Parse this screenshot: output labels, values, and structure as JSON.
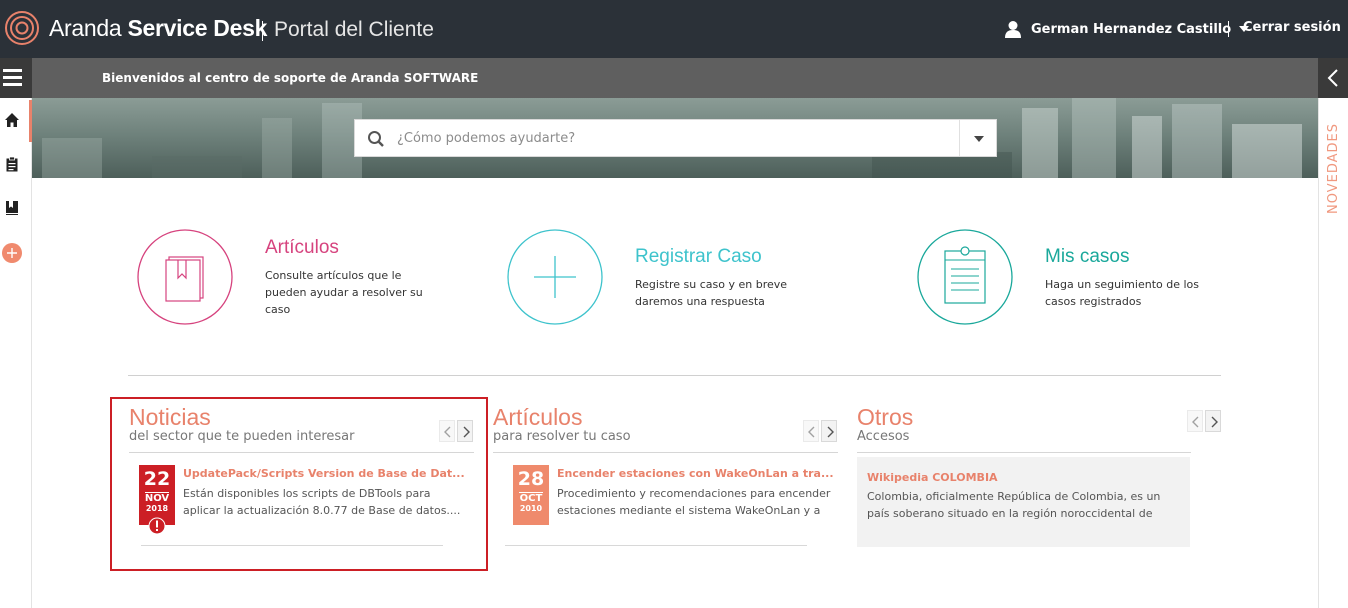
{
  "header": {
    "brand_light": "Aranda ",
    "brand_bold": "Service Desk",
    "portal": "Portal del Cliente",
    "user_name": "German Hernandez Castillo",
    "logout": "Cerrar sesión"
  },
  "subbar": {
    "welcome": "Bienvenidos al centro de soporte de Aranda SOFTWARE"
  },
  "sidebar_right": {
    "label": "NOVEDADES"
  },
  "search": {
    "placeholder": "¿Cómo podemos ayudarte?"
  },
  "features": [
    {
      "title": "Artículos",
      "desc": "Consulte artículos que le pueden ayudar a resolver su caso",
      "color": "#d6437e",
      "icon": "book-icon"
    },
    {
      "title": "Registrar Caso",
      "desc": "Registre su caso y en breve daremos una respuesta",
      "color": "#3ec3cc",
      "icon": "plus-icon"
    },
    {
      "title": "Mis casos",
      "desc": "Haga un seguimiento de los casos registrados",
      "color": "#1aa89b",
      "icon": "clipboard-icon"
    }
  ],
  "panels": {
    "noticias": {
      "title": "Noticias",
      "subtitle": "del sector que te pueden interesar",
      "item": {
        "day": "22",
        "month": "NOV",
        "year": "2018",
        "title": "UpdatePack/Scripts Version de Base de Dat...",
        "text": "Están disponibles los scripts de DBTools para aplicar la actualización 8.0.77 de Base de datos...."
      }
    },
    "articulos": {
      "title": "Artículos",
      "subtitle": "para resolver tu caso",
      "item": {
        "day": "28",
        "month": "OCT",
        "year": "2010",
        "title": "Encender estaciones con WakeOnLan a tra...",
        "text": "Procedimiento y recomendaciones para encender estaciones mediante el sistema WakeOnLan y a"
      }
    },
    "otros": {
      "title": "Otros",
      "subtitle": "Accesos",
      "item": {
        "title": "Wikipedia COLOMBIA",
        "text": "Colombia, oficialmente República de Colombia, es un país soberano situado en la región noroccidental de"
      }
    }
  },
  "colors": {
    "accent": "#e8826b",
    "topbar": "#2b3138",
    "highlight": "#cc1f25",
    "news_badge": "#cc1f25"
  }
}
